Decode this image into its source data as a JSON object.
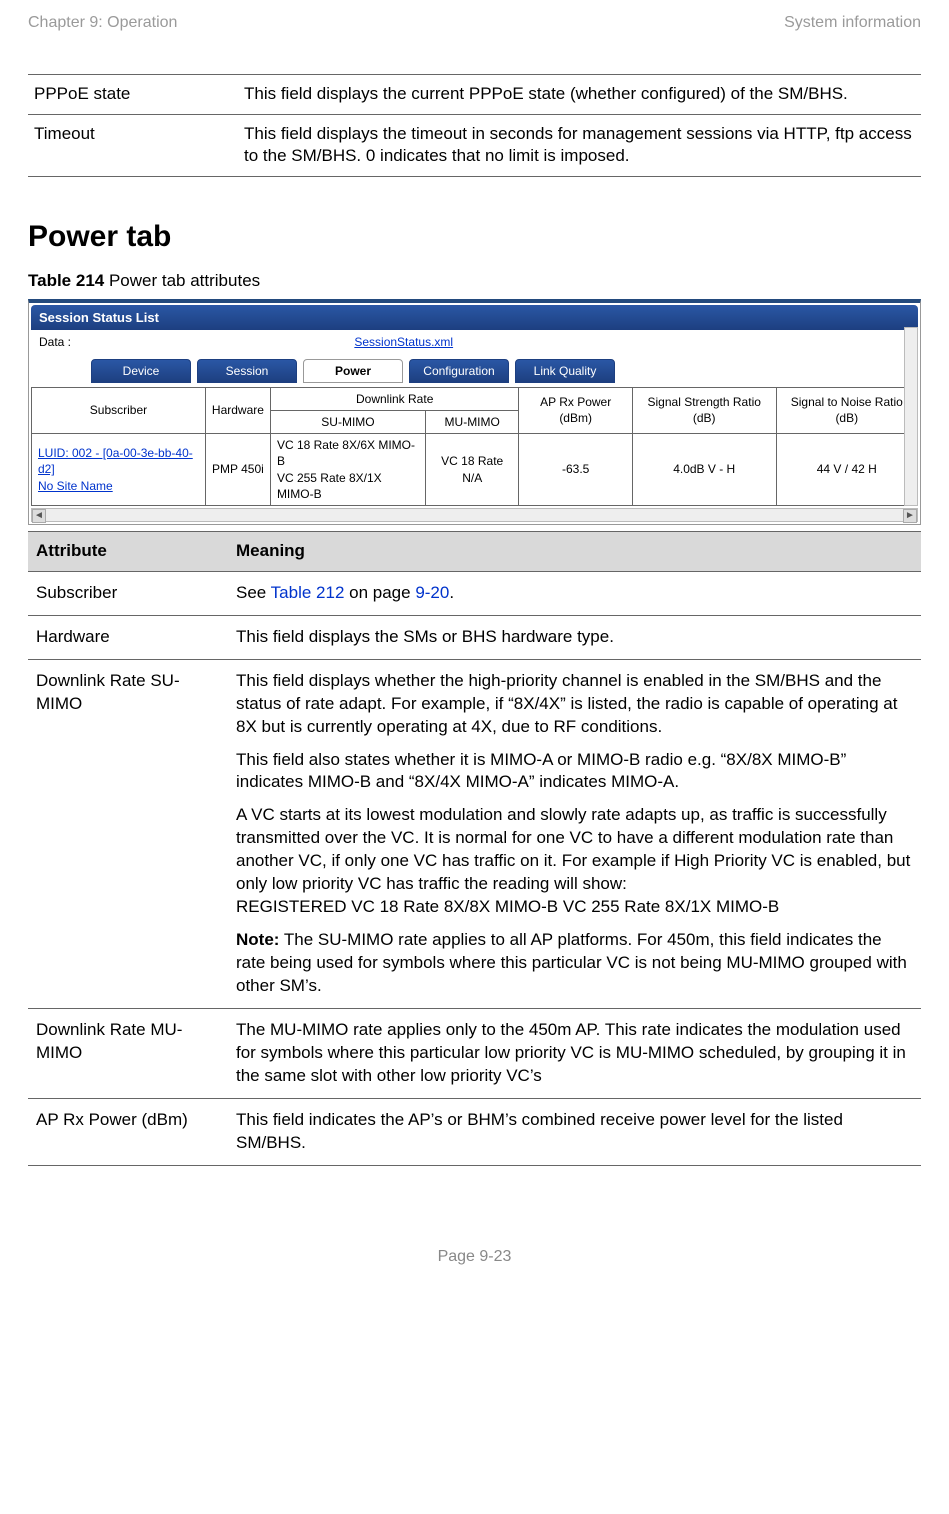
{
  "header": {
    "left": "Chapter 9:  Operation",
    "right": "System information"
  },
  "top_table": [
    {
      "attr": "PPPoE state",
      "meaning": "This field displays the current PPPoE state (whether configured) of the SM/BHS."
    },
    {
      "attr": "Timeout",
      "meaning": "This field displays the timeout in seconds for management sessions via HTTP, ftp access to the SM/BHS. 0 indicates that no limit is imposed."
    }
  ],
  "section_title": "Power tab",
  "table_caption": {
    "bold": "Table 214",
    "rest": " Power tab attributes"
  },
  "screenshot": {
    "title": "Session Status List",
    "data_label": "Data :",
    "data_link": "SessionStatus.xml",
    "tabs": [
      "Device",
      "Session",
      "Power",
      "Configuration",
      "Link Quality"
    ],
    "active_tab": 2,
    "columns": {
      "subscriber": "Subscriber",
      "hardware": "Hardware",
      "downlink_rate": "Downlink Rate",
      "su": "SU-MIMO",
      "mu": "MU-MIMO",
      "ap_rx": "AP Rx Power (dBm)",
      "sig_str": "Signal Strength Ratio (dB)",
      "snr": "Signal to Noise Ratio (dB)"
    },
    "row": {
      "subscriber_line1": "LUID: 002 - [0a-00-3e-bb-40-d2]",
      "subscriber_line2": "No Site Name",
      "hardware": "PMP 450i",
      "su": "VC 18 Rate 8X/6X MIMO-B\nVC 255 Rate 8X/1X MIMO-B",
      "mu": "VC 18 Rate N/A",
      "ap_rx": "-63.5",
      "sig_str": "4.0dB V - H",
      "snr": "44 V / 42 H"
    }
  },
  "attr_headers": {
    "attribute": "Attribute",
    "meaning": "Meaning"
  },
  "attributes": {
    "subscriber": {
      "label": "Subscriber",
      "prefix": "See ",
      "link": "Table 212",
      "mid": " on page ",
      "page": "9-20",
      "suffix": "."
    },
    "hardware": {
      "label": "Hardware",
      "text": "This field displays the SMs or BHS hardware type."
    },
    "dlsu": {
      "label": "Downlink Rate  SU-MIMO",
      "p1": "This field displays whether the high-priority channel is enabled in the SM/BHS and the status of rate adapt. For example, if “8X/4X” is listed, the radio is capable of operating at 8X but is currently operating at 4X, due to RF conditions.",
      "p2": "This field also states whether it is MIMO-A or MIMO-B radio e.g. “8X/8X MIMO-B” indicates MIMO-B and “8X/4X MIMO-A” indicates MIMO-A.",
      "p3a": "A VC starts at its lowest modulation and slowly rate adapts up, as traffic is successfully transmitted over the VC. It is normal for one VC to have a different modulation rate than another VC, if only one VC has traffic on it. For example if High Priority VC is enabled, but only low priority VC has traffic the reading will show:",
      "p3b": "REGISTERED VC 18 Rate 8X/8X MIMO-B VC 255 Rate 8X/1X MIMO-B",
      "note_label": "Note:",
      "note_text": " The SU-MIMO rate applies to all AP platforms. For 450m, this field indicates the rate being used for symbols where this particular VC is not being MU-MIMO grouped with other SM’s."
    },
    "dlmu": {
      "label": "Downlink Rate  MU-MIMO",
      "text": "The MU-MIMO rate applies only to the 450m AP. This rate indicates the modulation used for symbols where this particular low priority VC is MU-MIMO scheduled, by grouping it in the same slot with other low priority VC’s"
    },
    "aprx": {
      "label": "AP Rx Power (dBm)",
      "text": "This field indicates the AP’s or BHM’s combined receive power level for the listed SM/BHS."
    }
  },
  "footer": "Page 9-23"
}
